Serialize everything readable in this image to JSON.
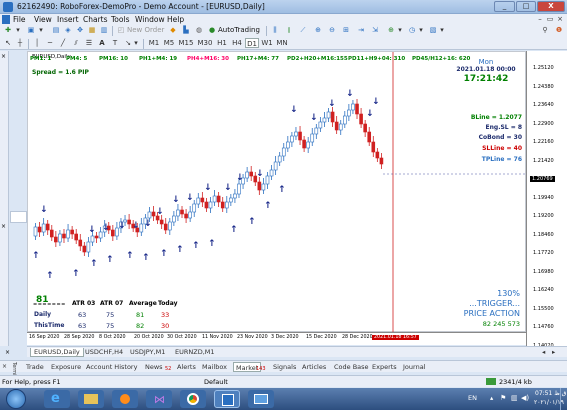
{
  "window": {
    "title": "62162490: RoboForex-DemoPro - Demo Account - [EURUSD,Daily]",
    "min": "_",
    "max": "□",
    "close": "X"
  },
  "menu": [
    "File",
    "View",
    "Insert",
    "Charts",
    "Tools",
    "Window",
    "Help"
  ],
  "toolbar": {
    "new_order": "New Order",
    "auto_trading": "AutoTrading"
  },
  "timeframes": [
    "M1",
    "M5",
    "M15",
    "M30",
    "H1",
    "H4",
    "D1",
    "W1",
    "MN"
  ],
  "chart": {
    "label": "EURUSD,Daily",
    "top_stats": [
      {
        "text": "PM1: 1",
        "color": "#008000"
      },
      {
        "text": "PM4: 5",
        "color": "#008000"
      },
      {
        "text": "PM16: 10",
        "color": "#008000"
      },
      {
        "text": "PH1+M4: 19",
        "color": "#008000"
      },
      {
        "text": "PH4+M16: 30",
        "color": "#ff0066"
      },
      {
        "text": "PH17+M4: 77",
        "color": "#008000"
      },
      {
        "text": "PD2+H20+M16:155",
        "color": "#008000"
      },
      {
        "text": "PD11+H9+04: 310",
        "color": "#008000"
      },
      {
        "text": "PD45/H12+16: 620",
        "color": "#008000"
      }
    ],
    "spread": "Spread = 1.6  PIP",
    "day": "Mon",
    "date": "2021.01.18 00:00",
    "time": "17:21:42",
    "bline": "BLine = 1.2077",
    "engsl": "Eng.SL = 8",
    "cobond": "CoBond = 30",
    "slline": "SLLine = 40",
    "tpline": "TPLine = 76",
    "big_value": "81",
    "underline": "=======",
    "table": {
      "headers": [
        "ATR 03",
        "ATR 07",
        "Average",
        "Today"
      ],
      "rows": [
        {
          "label": "Daily",
          "values": [
            "63",
            "75",
            "81",
            "33"
          ]
        },
        {
          "label": "ThisTime",
          "values": [
            "63",
            "75",
            "82",
            "30"
          ]
        }
      ]
    },
    "trigger_pct": "130%",
    "trigger": "...TRIGGER...",
    "price_action": "PRICE ACTION",
    "trigger_values": "82  245  573",
    "price_labels": [
      "1.25120",
      "1.24380",
      "1.23640",
      "1.22900",
      "1.22160",
      "1.21420",
      "1.20769",
      "1.19940",
      "1.19200",
      "1.18460",
      "1.17720",
      "1.16980",
      "1.16240",
      "1.15500",
      "1.14760",
      "1.14020"
    ],
    "time_labels": [
      "16 Sep 2020",
      "28 Sep 2020",
      "8 Oct 2020",
      "20 Oct 2020",
      "30 Oct 2020",
      "11 Nov 2020",
      "23 Nov 2020",
      "3 Dec 2020",
      "15 Dec 2020",
      "28 Dec 2020",
      "2021.01.18 16:57"
    ]
  },
  "chart_tabs": [
    "EURUSD,Daily",
    "USDCHF,H4",
    "USDJPY,M1",
    "EURNZD,M1"
  ],
  "terminal_tabs": [
    "Trade",
    "Exposure",
    "Account History",
    "News",
    "Alerts",
    "Mailbox",
    "Market",
    "Signals",
    "Articles",
    "Code Base",
    "Experts",
    "Journal"
  ],
  "terminal_badges": {
    "news": "52",
    "market": "143"
  },
  "terminal_label": "Terminal",
  "status": {
    "help": "For Help, press F1",
    "profile": "Default",
    "traffic": "2341/4 kb"
  },
  "taskbar": {
    "lang": "EN",
    "clock_time": "07:51 ق.ظ",
    "clock_date": "۲۰۲۱/۰۱/۱۹"
  }
}
